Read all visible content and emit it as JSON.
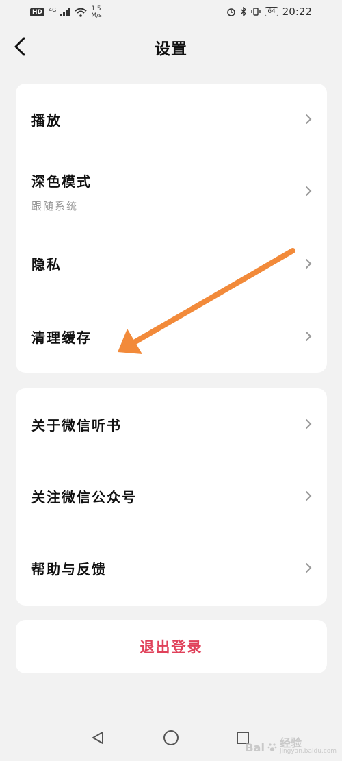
{
  "status_bar": {
    "hd": "HD",
    "network": "4G",
    "speed_value": "1.5",
    "speed_unit": "M/s",
    "battery": "64",
    "time": "20:22"
  },
  "header": {
    "title": "设置"
  },
  "section1": {
    "items": [
      {
        "label": "播放"
      },
      {
        "label": "深色模式",
        "sub": "跟随系统"
      },
      {
        "label": "隐私"
      },
      {
        "label": "清理缓存"
      }
    ]
  },
  "section2": {
    "items": [
      {
        "label": "关于微信听书"
      },
      {
        "label": "关注微信公众号"
      },
      {
        "label": "帮助与反馈"
      }
    ]
  },
  "logout": {
    "label": "退出登录"
  },
  "watermark": {
    "brand": "Bai",
    "brand2": "经验",
    "domain": "jingyan.baidu.com"
  },
  "colors": {
    "background": "#f2f2f2",
    "card": "#ffffff",
    "logout_text": "#e0415a",
    "annotation_arrow": "#f28a3a",
    "subtitle": "#999999"
  },
  "icons": {
    "back": "chevron-left-icon",
    "row_chevron": "chevron-right-icon",
    "nav_back": "triangle-back-icon",
    "nav_home": "circle-home-icon",
    "nav_recents": "square-recents-icon"
  }
}
